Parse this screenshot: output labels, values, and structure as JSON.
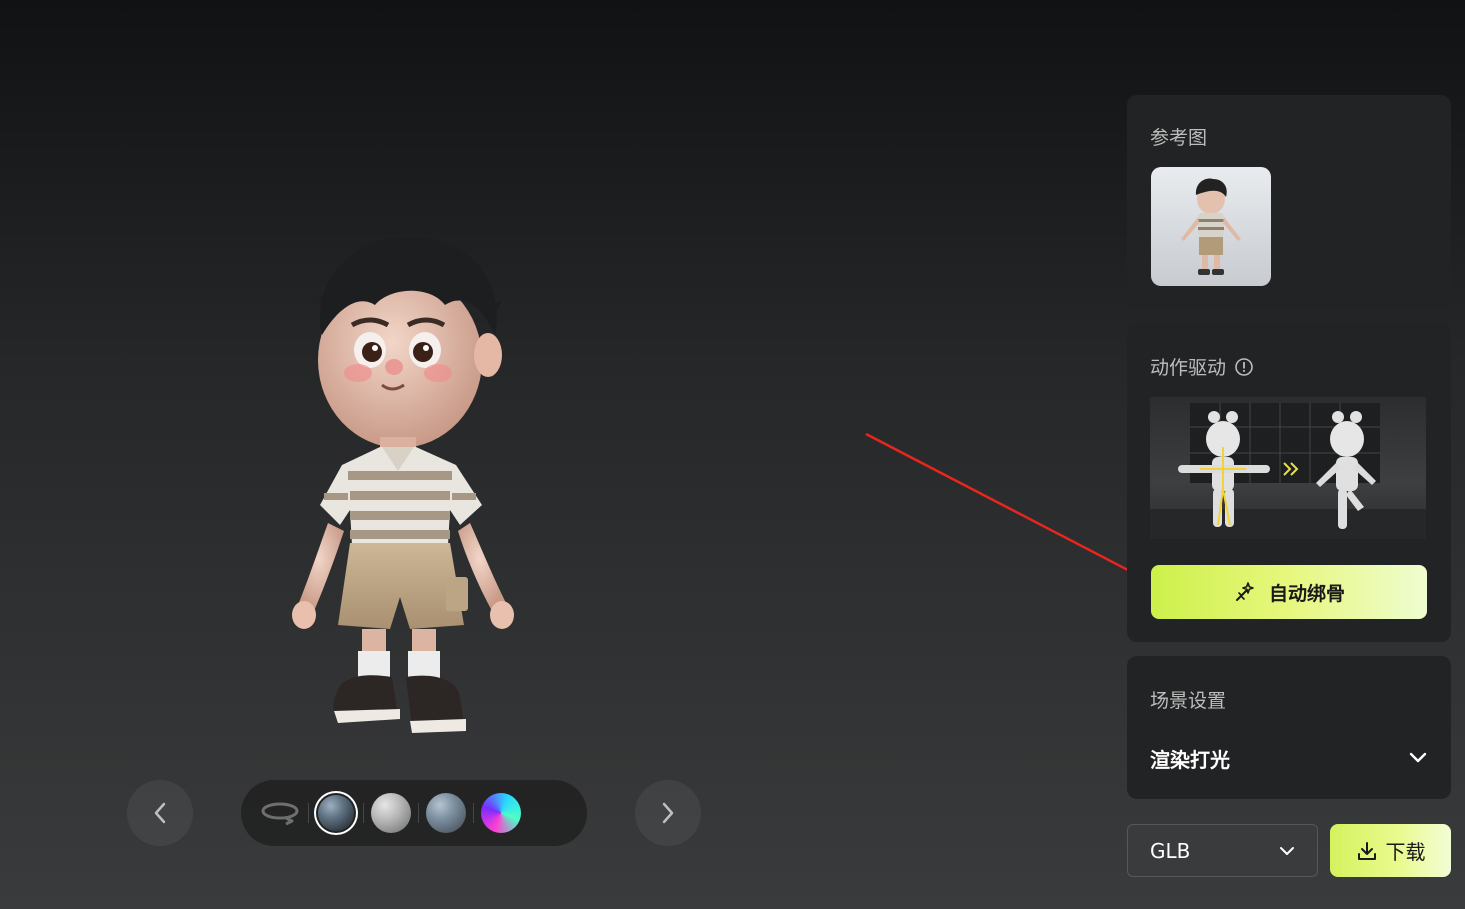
{
  "viewer": {
    "prev_label": "",
    "next_label": "",
    "materials": [
      "rotate-icon",
      "rock-material",
      "clay-material",
      "stone-material",
      "rainbow-material"
    ],
    "selected_material": "rock-material"
  },
  "panels": {
    "reference": {
      "title": "参考图"
    },
    "motion": {
      "title": "动作驱动",
      "auto_rig_label": "自动绑骨"
    },
    "scene": {
      "title": "场景设置",
      "lighting_label": "渲染打光"
    }
  },
  "export": {
    "format_value": "GLB",
    "download_label": "下载"
  },
  "colors": {
    "accent_start": "#cdf04a",
    "accent_end": "#eefdd0",
    "panel_bg": "#222324",
    "annotation_arrow": "#e8261f"
  }
}
